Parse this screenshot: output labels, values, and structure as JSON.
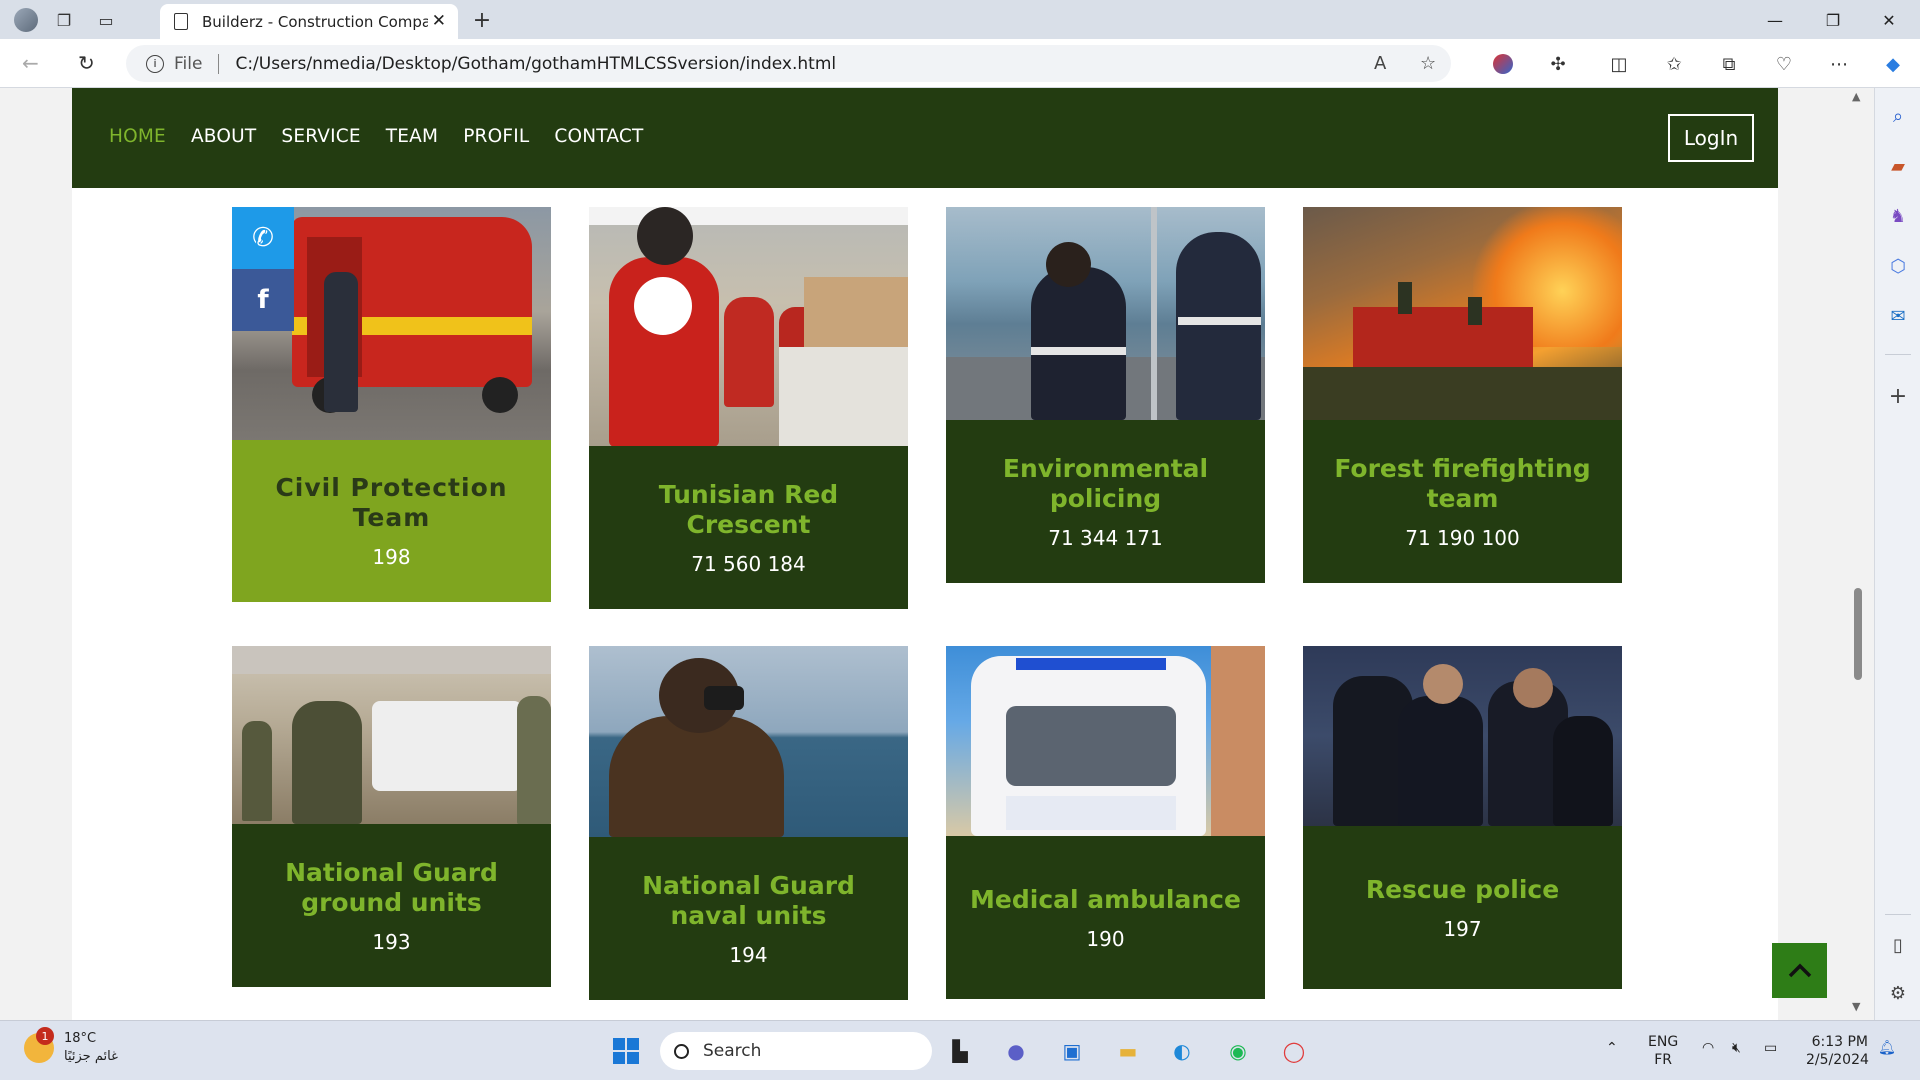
{
  "browser": {
    "tab_title": "Builderz - Construction Company",
    "address_scheme": "File",
    "address_url": "C:/Users/nmedia/Desktop/Gotham/gothamHTMLCSSversion/index.html"
  },
  "site": {
    "nav": [
      {
        "label": "HOME",
        "active": true
      },
      {
        "label": "ABOUT",
        "active": false
      },
      {
        "label": "SERVICE",
        "active": false
      },
      {
        "label": "TEAM",
        "active": false
      },
      {
        "label": "PROFIL",
        "active": false
      },
      {
        "label": "CONTACT",
        "active": false
      }
    ],
    "login_label": "LogIn"
  },
  "cards": [
    {
      "title": "Civil Protection Team",
      "number": "198",
      "image": "ambulance-red-truck-photo"
    },
    {
      "title": "Tunisian Red Crescent",
      "number": "71 560 184",
      "image": "red-crescent-volunteers-photo"
    },
    {
      "title": "Environmental policing",
      "number": "71 344 171",
      "image": "boat-officers-photo"
    },
    {
      "title": "Forest firefighting team",
      "number": "71 190 100",
      "image": "forest-fire-truck-photo"
    },
    {
      "title": "National Guard ground units",
      "number": "193",
      "image": "guard-vehicles-photo"
    },
    {
      "title": "National Guard naval units",
      "number": "194",
      "image": "binoculars-sea-photo"
    },
    {
      "title": "Medical ambulance",
      "number": "190",
      "image": "ambulance-van-photo"
    },
    {
      "title": "Rescue police",
      "number": "197",
      "image": "police-officers-photo"
    }
  ],
  "taskbar": {
    "weather_temp": "18°C",
    "weather_desc": "غائم جزئيًا",
    "weather_badge": "1",
    "search_label": "Search",
    "lang_top": "ENG",
    "lang_bottom": "FR",
    "time": "6:13 PM",
    "date": "2/5/2024"
  },
  "colors": {
    "nav_bg": "#233c11",
    "accent_green": "#7fb52c",
    "highlight_panel": "#7fa51f",
    "to_top_button": "#2e7d17"
  }
}
